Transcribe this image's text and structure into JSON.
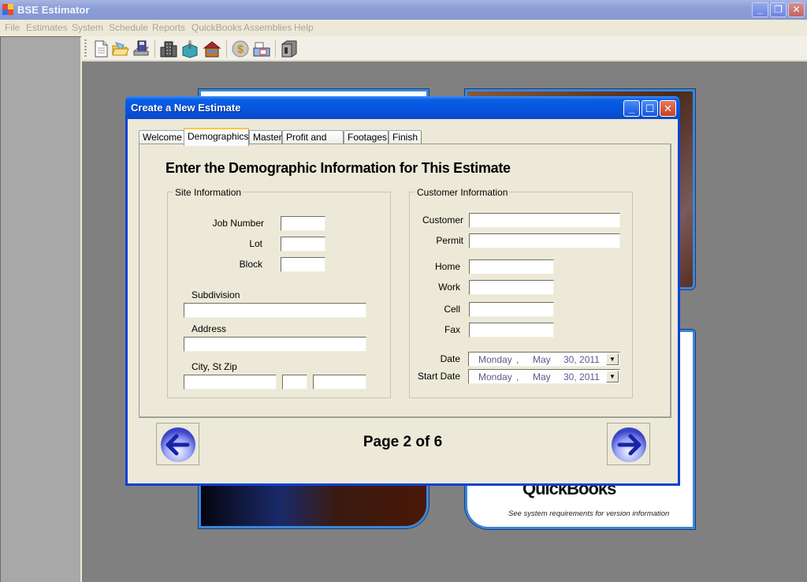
{
  "app": {
    "title": "BSE Estimator",
    "window_controls": {
      "minimize": "_",
      "restore": "❐",
      "close": "✕"
    }
  },
  "menu": {
    "items": [
      "File",
      "Estimates",
      "System",
      "Schedule",
      "Reports",
      "QuickBooks",
      "Assemblies",
      "Help"
    ]
  },
  "toolbar": {
    "buttons": [
      {
        "icon": "new-document-icon"
      },
      {
        "icon": "open-folder-icon"
      },
      {
        "icon": "save-disk-icon"
      },
      {
        "icon": "building-icon"
      },
      {
        "icon": "toolbox-icon"
      },
      {
        "icon": "house-icon"
      },
      {
        "icon": "money-coin-icon"
      },
      {
        "icon": "print-icon"
      },
      {
        "icon": "safe-icon"
      }
    ]
  },
  "background": {
    "splash_caption": "See system requirements for version information",
    "splash_brand": "QuickBooks"
  },
  "dialog": {
    "title": "Create a New Estimate",
    "controls": {
      "minimize": "_",
      "maximize": "☐",
      "close": "✕"
    },
    "tabs": [
      {
        "label": "Welcome",
        "active": false
      },
      {
        "label": "Demographics",
        "active": true
      },
      {
        "label": "Master",
        "active": false
      },
      {
        "label": "Profit and Tax",
        "active": false
      },
      {
        "label": "Footages",
        "active": false
      },
      {
        "label": "Finish",
        "active": false
      }
    ],
    "heading": "Enter the Demographic Information for This Estimate",
    "site_info": {
      "legend": "Site Information",
      "job_number": {
        "label": "Job Number",
        "value": ""
      },
      "lot": {
        "label": "Lot",
        "value": ""
      },
      "block": {
        "label": "Block",
        "value": ""
      },
      "subdivision": {
        "label": "Subdivision",
        "value": ""
      },
      "address": {
        "label": "Address",
        "value": ""
      },
      "city_st_zip": {
        "label": "City, St Zip",
        "city": "",
        "state": "",
        "zip": ""
      }
    },
    "customer_info": {
      "legend": "Customer Information",
      "customer": {
        "label": "Customer",
        "value": ""
      },
      "permit": {
        "label": "Permit",
        "value": ""
      },
      "home": {
        "label": "Home",
        "value": ""
      },
      "work": {
        "label": "Work",
        "value": ""
      },
      "cell": {
        "label": "Cell",
        "value": ""
      },
      "fax": {
        "label": "Fax",
        "value": ""
      },
      "date": {
        "label": "Date",
        "weekday": "Monday",
        "sep": ",",
        "month": "May",
        "day_year": "30, 2011"
      },
      "start_date": {
        "label": "Start Date",
        "weekday": "Monday",
        "sep": ",",
        "month": "May",
        "day_year": "30, 2011"
      }
    },
    "navigation": {
      "page_indicator": "Page 2 of 6",
      "back_icon": "arrow-left-icon",
      "next_icon": "arrow-right-icon"
    }
  },
  "colors": {
    "dialog_title_blue": "#0453dd",
    "dialog_face": "#ece9d8",
    "desktop_gray": "#808080",
    "menu_disabled_text": "#a9a699"
  }
}
